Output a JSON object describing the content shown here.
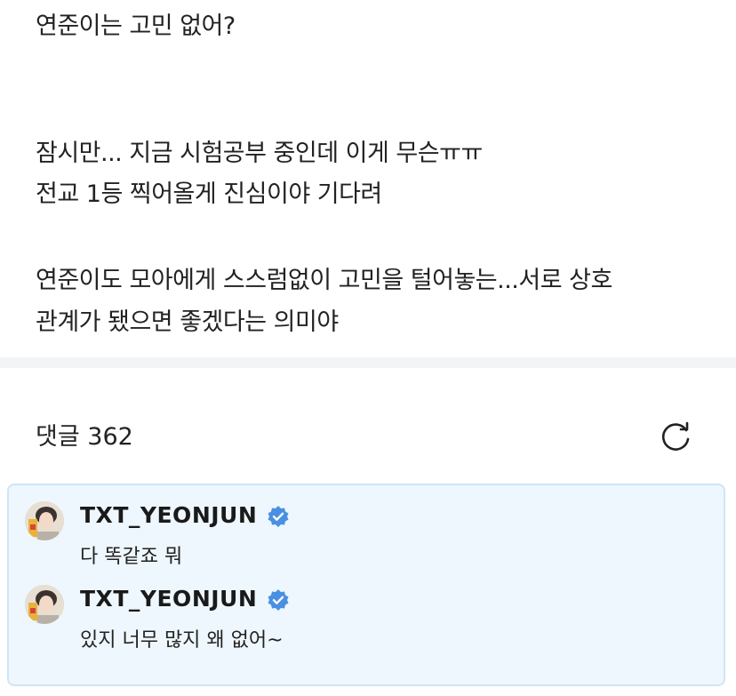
{
  "post": {
    "lines": [
      "연준이는 고민 없어?",
      "잠시만... 지금 시험공부 중인데 이게 무슨ㅠㅠ",
      "전교 1등 찍어올게 진심이야 기다려",
      "연준이도 모아에게 스스럼없이 고민을 털어놓는...서로 상호",
      "관계가 됐으면 좋겠다는 의미야"
    ]
  },
  "comments": {
    "title": "댓글 362",
    "refresh_icon": "refresh-icon",
    "items": [
      {
        "author": "TXT_YEONJUN",
        "verified": true,
        "text": "다 똑같죠 뭐"
      },
      {
        "author": "TXT_YEONJUN",
        "verified": true,
        "text": "있지 너무 많지 왜 없어~"
      }
    ]
  },
  "colors": {
    "highlight_bg": "#eef7fd",
    "highlight_border": "#cfe6f5",
    "verified_blue": "#4a90e2",
    "divider": "#f3f4f6"
  }
}
